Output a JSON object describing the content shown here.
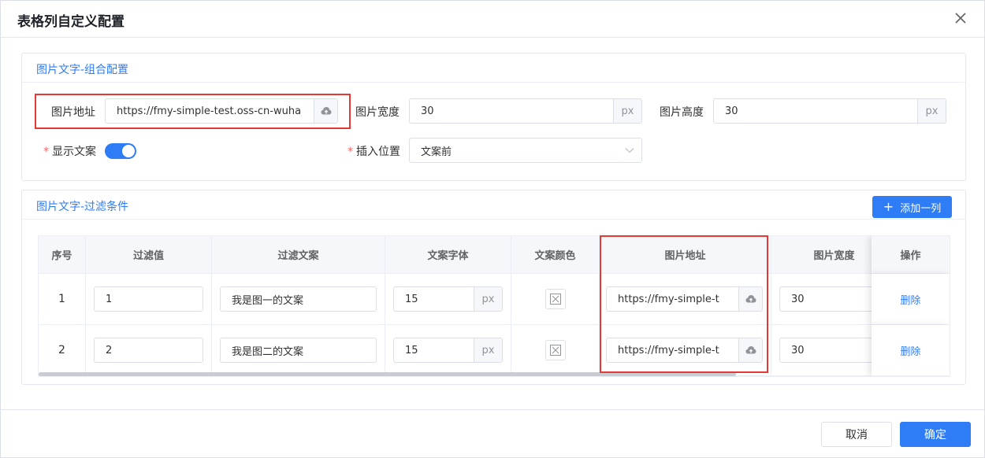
{
  "dialog": {
    "title": "表格列自定义配置"
  },
  "combo_section": {
    "title": "图片文字-组合配置",
    "image_url_label": "图片地址",
    "image_url_value": "https://fmy-simple-test.oss-cn-wuha",
    "image_width_label": "图片宽度",
    "image_width_value": "30",
    "image_width_unit": "px",
    "image_height_label": "图片高度",
    "image_height_value": "30",
    "image_height_unit": "px",
    "show_text_label": "显示文案",
    "show_text_on": true,
    "insert_pos_label": "插入位置",
    "insert_pos_value": "文案前"
  },
  "filter_section": {
    "title": "图片文字-过滤条件",
    "add_button": "添加一列",
    "columns": [
      "序号",
      "过滤值",
      "过滤文案",
      "文案字体",
      "文案颜色",
      "图片地址",
      "图片宽度",
      "操作"
    ],
    "rows": [
      {
        "index": "1",
        "filter_value": "1",
        "filter_text": "我是图一的文案",
        "font_size": "15",
        "font_unit": "px",
        "image_url": "https://fmy-simple-t",
        "image_width": "30",
        "action": "删除"
      },
      {
        "index": "2",
        "filter_value": "2",
        "filter_text": "我是图二的文案",
        "font_size": "15",
        "font_unit": "px",
        "image_url": "https://fmy-simple-t",
        "image_width": "30",
        "action": "删除"
      }
    ]
  },
  "footer": {
    "cancel": "取消",
    "confirm": "确定"
  },
  "colors": {
    "primary": "#2e7cf6",
    "required": "#f56c6c",
    "highlight_box": "#e53935"
  }
}
